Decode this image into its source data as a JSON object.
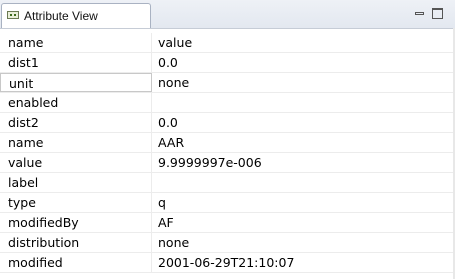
{
  "view": {
    "tab_label": "Attribute View",
    "tab_icon": "attribute-view-icon",
    "controls": [
      "minimize-icon",
      "maximize-icon"
    ]
  },
  "table": {
    "columns": [
      "name",
      "value"
    ],
    "rows": [
      {
        "name": "dist1",
        "value": "0.0"
      },
      {
        "name": "unit",
        "value": "none"
      },
      {
        "name": "enabled",
        "value": ""
      },
      {
        "name": "dist2",
        "value": "0.0"
      },
      {
        "name": "name",
        "value": "AAR"
      },
      {
        "name": "value",
        "value": "9.9999997e-006"
      },
      {
        "name": "label",
        "value": ""
      },
      {
        "name": "type",
        "value": "q"
      },
      {
        "name": "modifiedBy",
        "value": "AF"
      },
      {
        "name": "distribution",
        "value": "none"
      },
      {
        "name": "modified",
        "value": "2001-06-29T21:10:07"
      }
    ],
    "selected_row": "unit"
  }
}
